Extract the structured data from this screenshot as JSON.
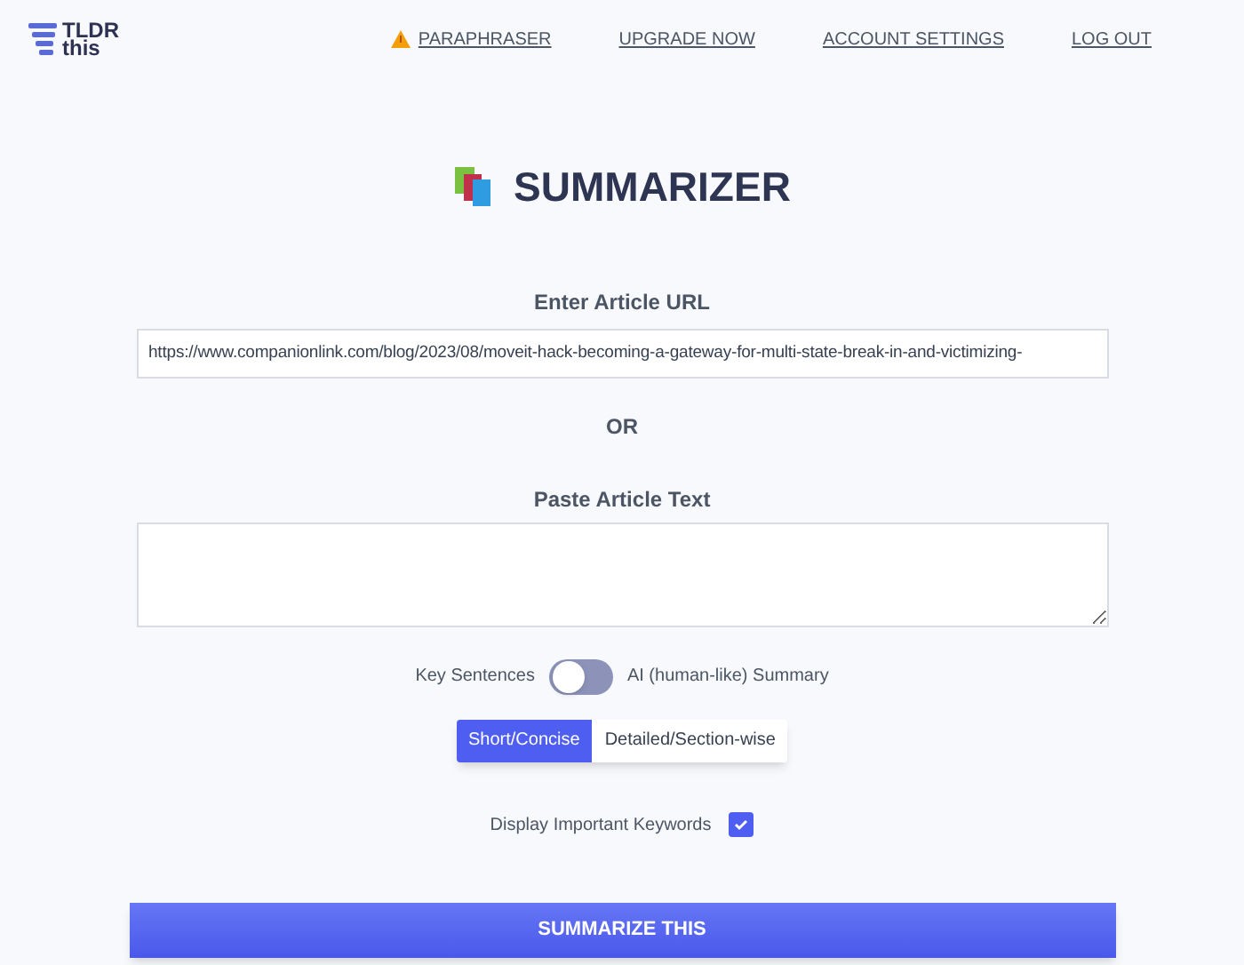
{
  "logo": {
    "line1": "TLDR",
    "line2": "this"
  },
  "nav": [
    {
      "label": "PARAPHRASER",
      "kind": "warning"
    },
    {
      "label": "UPGRADE NOW",
      "kind": "plain"
    },
    {
      "label": "ACCOUNT SETTINGS",
      "kind": "plain"
    },
    {
      "label": "LOG OUT",
      "kind": "plain"
    }
  ],
  "title": "SUMMARIZER",
  "url_label": "Enter Article URL",
  "url_value": "https://www.companionlink.com/blog/2023/08/moveit-hack-becoming-a-gateway-for-multi-state-break-in-and-victimizing-",
  "or": "OR",
  "text_label": "Paste Article Text",
  "mode": {
    "left": "Key Sentences",
    "right": "AI (human-like) Summary",
    "on": false
  },
  "lengths": [
    {
      "label": "Short/Concise",
      "selected": true
    },
    {
      "label": "Detailed/Section-wise",
      "selected": false
    }
  ],
  "keywords": {
    "label": "Display Important Keywords",
    "checked": true
  },
  "submit": "SUMMARIZE THIS"
}
